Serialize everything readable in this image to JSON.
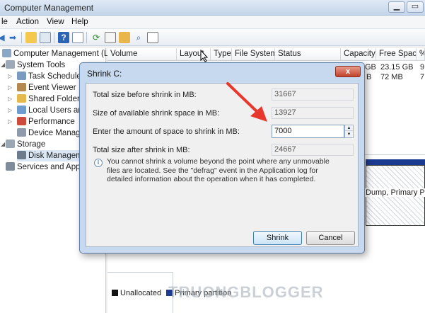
{
  "window": {
    "title": "Computer Management",
    "min_glyph": "▭",
    "max_glyph": "▭"
  },
  "menu": [
    "le",
    "Action",
    "View",
    "Help"
  ],
  "toolbar_icons": [
    "back-arrow-icon",
    "forward-arrow-icon",
    "up-folder-icon",
    "show-tree-icon",
    "help-icon",
    "console-icon",
    "refresh-icon",
    "export-icon",
    "open-icon",
    "search-icon",
    "properties-icon"
  ],
  "tree": {
    "items": [
      {
        "label": "Computer Management (Local",
        "level": 0
      },
      {
        "label": "System Tools",
        "level": 1
      },
      {
        "label": "Task Scheduler",
        "level": 2
      },
      {
        "label": "Event Viewer",
        "level": 2
      },
      {
        "label": "Shared Folders",
        "level": 2
      },
      {
        "label": "Local Users and",
        "level": 2
      },
      {
        "label": "Performance",
        "level": 2
      },
      {
        "label": "Device Manager",
        "level": 2
      },
      {
        "label": "Storage",
        "level": 1
      },
      {
        "label": "Disk Manageme",
        "level": 2
      },
      {
        "label": "Services and Applic",
        "level": 1
      }
    ]
  },
  "table": {
    "headers": [
      "Volume",
      "Layout",
      "Type",
      "File System",
      "Status",
      "Capacity",
      "Free Space",
      "%"
    ],
    "rows": [
      {
        "capacity_tail": "GB",
        "free": "23.15 GB",
        "pct": "9"
      },
      {
        "capacity_tail": "B",
        "free": "72 MB",
        "pct": "7"
      }
    ]
  },
  "disk_pane": {
    "partition_text": "Dump, Primary Par",
    "legend": [
      {
        "label": "Unallocated",
        "color": "#111111"
      },
      {
        "label": "Primary partition",
        "color": "#1c3a8f"
      }
    ],
    "watermark": "TRUONGBLOGGER"
  },
  "dialog": {
    "title": "Shrink C:",
    "close_glyph": "x",
    "rows": [
      {
        "label": "Total size before shrink in MB:",
        "value": "31667"
      },
      {
        "label": "Size of available shrink space in MB:",
        "value": "13927"
      },
      {
        "label": "Enter the amount of space to shrink in MB:",
        "value": "7000"
      },
      {
        "label": "Total size after shrink in MB:",
        "value": "24667"
      }
    ],
    "info_text": "You cannot shrink a volume beyond the point where any unmovable files are located. See the \"defrag\" event in the Application log for detailed information about the operation when it has completed.",
    "buttons": {
      "shrink": "Shrink",
      "cancel": "Cancel"
    }
  },
  "colors": {
    "accent_arrow": "#e8372c",
    "dialog_frame": "#c7d9ee"
  }
}
